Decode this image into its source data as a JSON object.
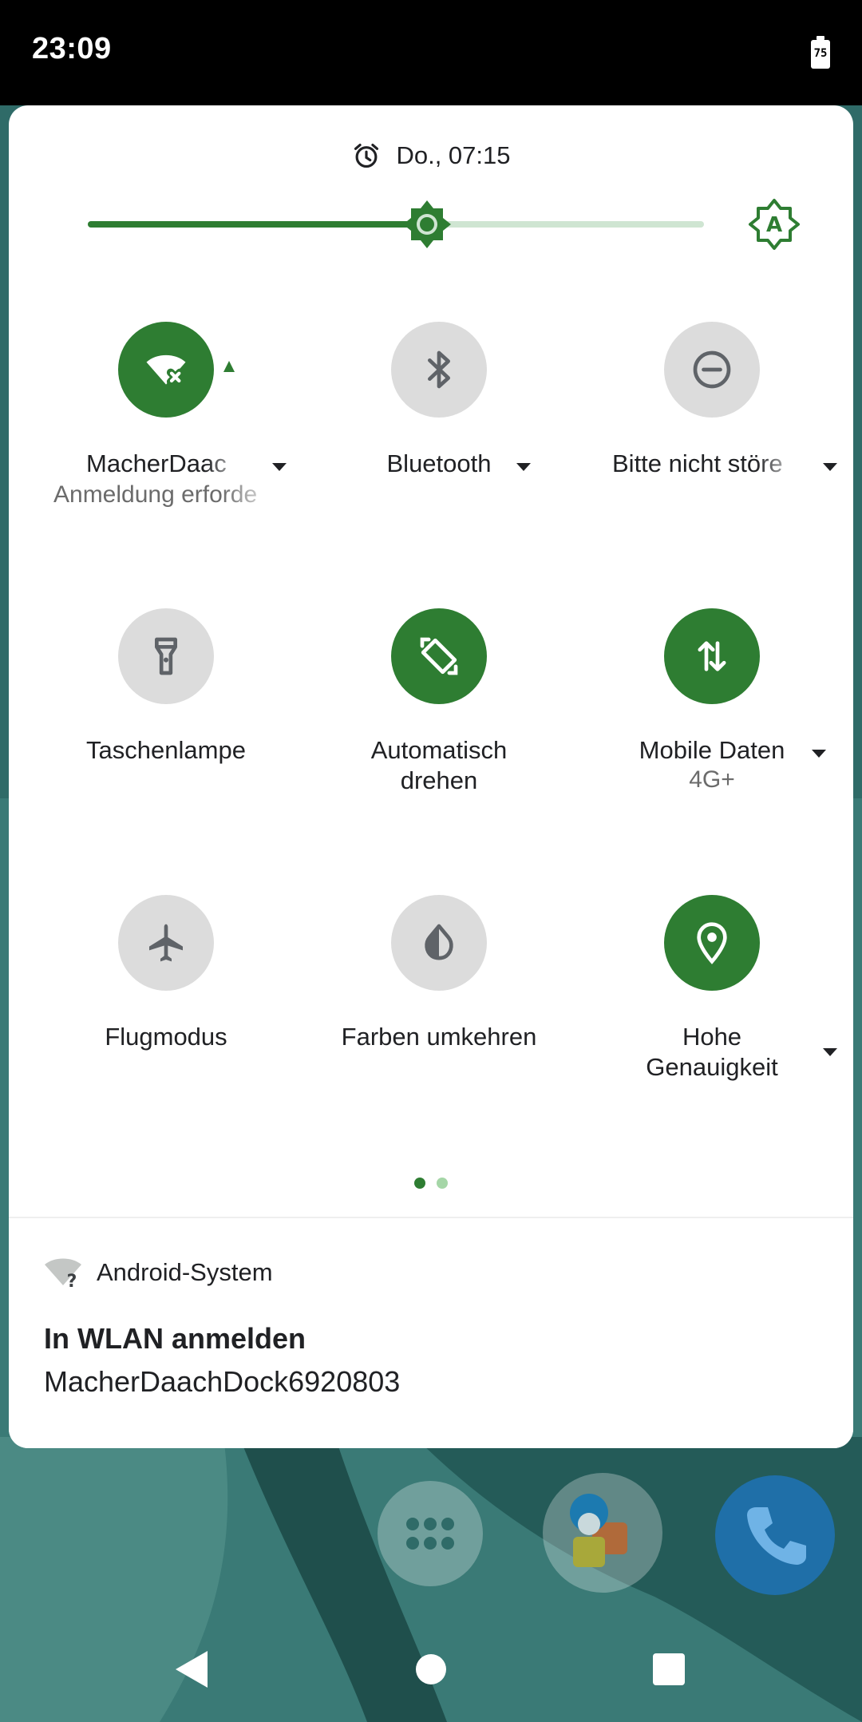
{
  "status_bar": {
    "time": "23:09",
    "battery_level": "75",
    "battery_icon": "battery-icon"
  },
  "quick_settings": {
    "alarm": {
      "icon": "alarm-clock-icon",
      "text": "Do., 07:15"
    },
    "brightness": {
      "level": 0.55,
      "auto_icon": "auto-brightness-icon"
    },
    "tiles": [
      {
        "label": "MacherDaac",
        "sublabel": "Anmeldung erforde",
        "icon": "wifi-login-icon",
        "state": "on",
        "has_dropdown": true
      },
      {
        "label": "Bluetooth",
        "icon": "bluetooth-icon",
        "state": "off",
        "has_dropdown": true
      },
      {
        "label": "Bitte nicht störe",
        "icon": "do-not-disturb-icon",
        "state": "off",
        "has_dropdown": true
      },
      {
        "label": "Taschenlampe",
        "icon": "flashlight-icon",
        "state": "off"
      },
      {
        "label": "Automatisch",
        "label2": "drehen",
        "icon": "auto-rotate-icon",
        "state": "on"
      },
      {
        "label": "Mobile Daten",
        "sublabel": "4G+",
        "icon": "mobile-data-icon",
        "state": "on",
        "has_dropdown": true
      },
      {
        "label": "Flugmodus",
        "icon": "airplane-icon",
        "state": "off"
      },
      {
        "label": "Farben umkehren",
        "icon": "invert-colors-icon",
        "state": "off"
      },
      {
        "label": "Hohe",
        "label2": "Genauigkeit",
        "icon": "location-icon",
        "state": "on",
        "has_dropdown": true
      }
    ],
    "page_indicator": {
      "pages": 2,
      "current": 1
    }
  },
  "notification": {
    "app_icon": "wifi-question-icon",
    "app_name": "Android-System",
    "title": "In WLAN anmelden",
    "text": "MacherDaachDock6920803"
  },
  "dock": [
    "app-drawer-icon",
    "contacts-icon",
    "phone-icon"
  ],
  "nav_bar": [
    "back-icon",
    "home-icon",
    "recents-icon"
  ],
  "colors": {
    "accent": "#2e7d32",
    "tile_off": "#dcdcdc",
    "brightness_track": "#cfe5d2",
    "wallpaper": "#2f6b68"
  }
}
